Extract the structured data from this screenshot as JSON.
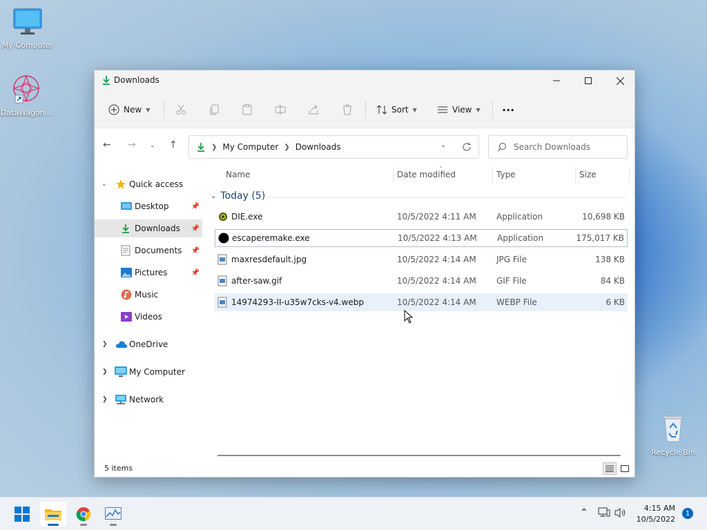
{
  "desktop": {
    "icons": [
      {
        "label": "My Computer"
      },
      {
        "label": "DataWagon..."
      },
      {
        "label": "Recycle Bin"
      }
    ]
  },
  "window": {
    "title": "Downloads",
    "toolbar": {
      "new_label": "New",
      "sort_label": "Sort",
      "view_label": "View",
      "more_label": "···"
    },
    "breadcrumb": [
      "My Computer",
      "Downloads"
    ],
    "search_placeholder": "Search Downloads",
    "nav": {
      "quick_access": "Quick access",
      "items": [
        {
          "label": "Desktop",
          "pinned": true
        },
        {
          "label": "Downloads",
          "pinned": true,
          "selected": true
        },
        {
          "label": "Documents",
          "pinned": true
        },
        {
          "label": "Pictures",
          "pinned": true
        },
        {
          "label": "Music",
          "pinned": false
        },
        {
          "label": "Videos",
          "pinned": false
        }
      ],
      "onedrive": "OneDrive",
      "my_computer": "My Computer",
      "network": "Network"
    },
    "columns": {
      "name": "Name",
      "date": "Date modified",
      "type": "Type",
      "size": "Size"
    },
    "group": {
      "label": "Today (5)"
    },
    "files": [
      {
        "name": "DIE.exe",
        "date": "10/5/2022 4:11 AM",
        "type": "Application",
        "size": "10,698 KB"
      },
      {
        "name": "escaperemake.exe",
        "date": "10/5/2022 4:13 AM",
        "type": "Application",
        "size": "175,017 KB"
      },
      {
        "name": "maxresdefault.jpg",
        "date": "10/5/2022 4:14 AM",
        "type": "JPG File",
        "size": "138 KB"
      },
      {
        "name": "after-saw.gif",
        "date": "10/5/2022 4:14 AM",
        "type": "GIF File",
        "size": "84 KB"
      },
      {
        "name": "14974293-II-u35w7cks-v4.webp",
        "date": "10/5/2022 4:14 AM",
        "type": "WEBP File",
        "size": "6 KB"
      }
    ],
    "status": "5 items"
  },
  "taskbar": {
    "time": "4:15 AM",
    "date": "10/5/2022",
    "notifications": "1"
  },
  "colors": {
    "accent": "#0067c0",
    "selection": "#e5e5e5",
    "hover": "#e8f1fb"
  }
}
